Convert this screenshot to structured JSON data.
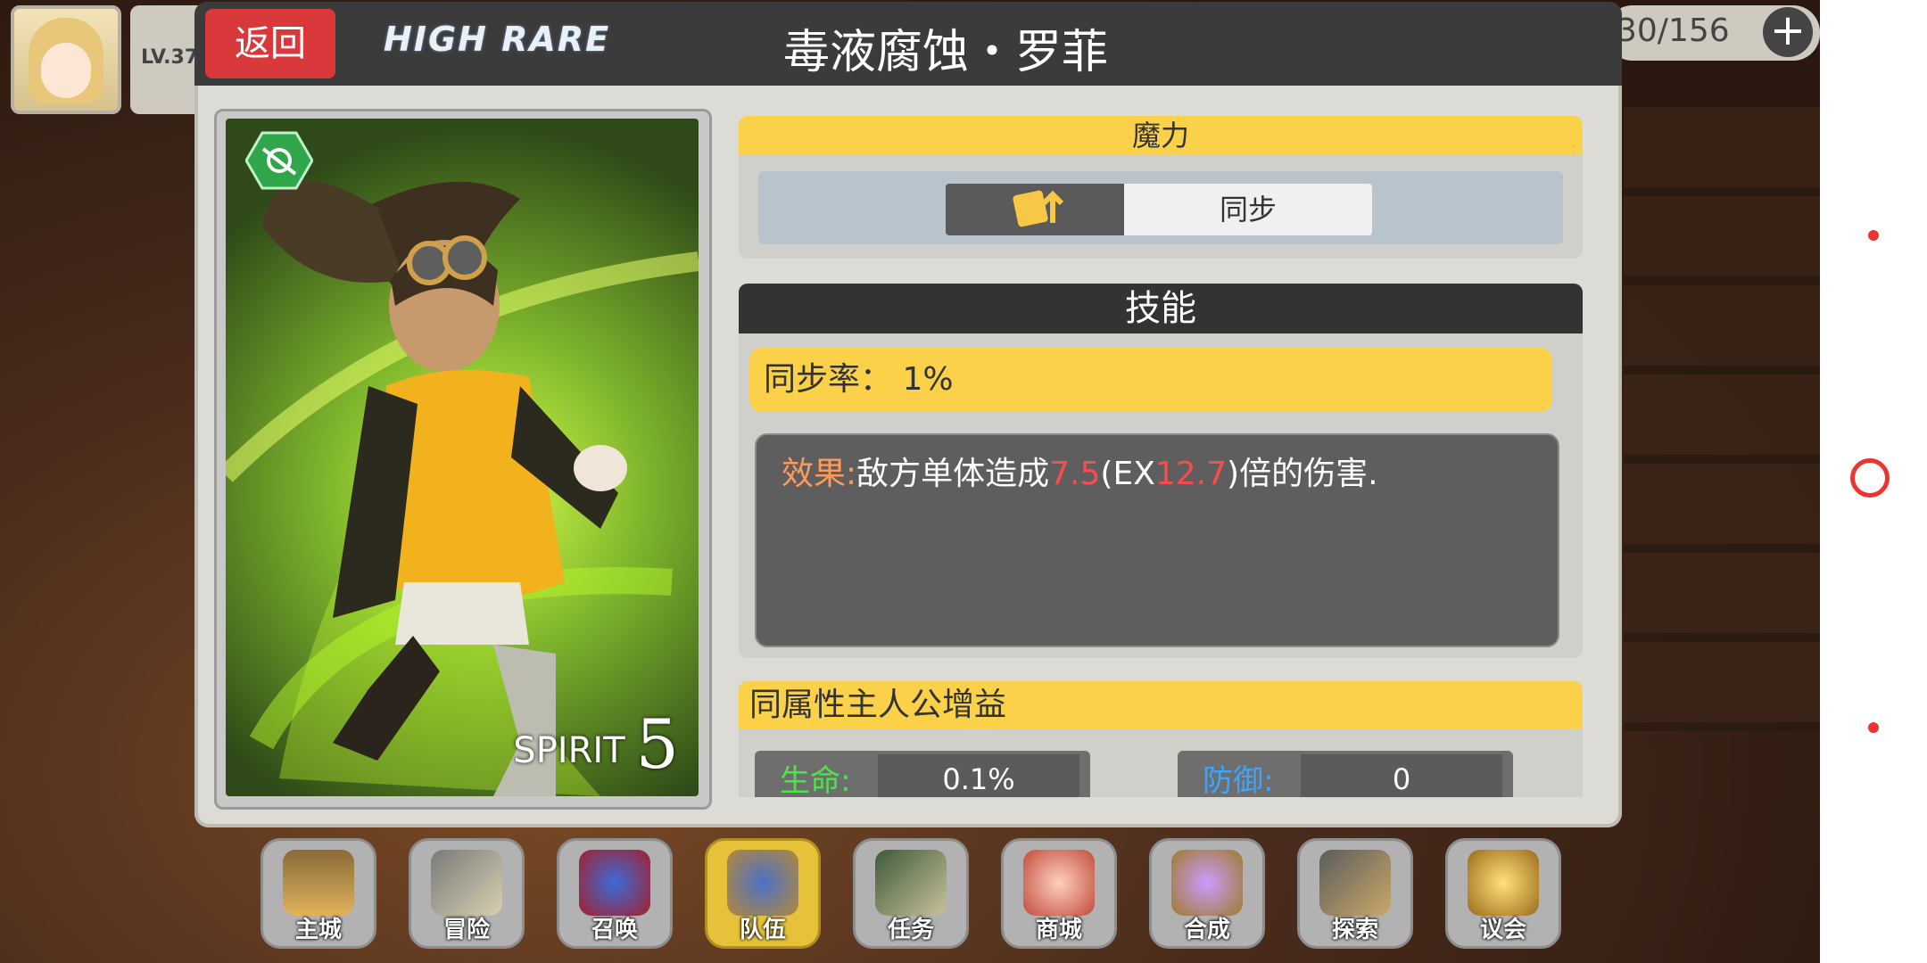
{
  "header": {
    "back_label": "返回",
    "rarity": "HIGH RARE",
    "title": "毒液腐蚀・罗菲"
  },
  "hud": {
    "level": "LV.37",
    "counter": "30/156",
    "plus": "+"
  },
  "card": {
    "spirit_label": "SPIRIT",
    "spirit_value": "5"
  },
  "magic": {
    "header": "魔力",
    "sync_label": "同步"
  },
  "skill": {
    "header": "技能",
    "sync_rate": "同步率： 1%",
    "effect_label": "效果:",
    "effect_text_1": "敌方单体造成",
    "effect_value_1": "7.5",
    "effect_text_2": "(EX",
    "effect_value_2": "12.7",
    "effect_text_3": ")倍的伤害."
  },
  "buff": {
    "header": "同属性主人公增益",
    "hp_label": "生命:",
    "hp_value": "0.1%",
    "def_label": "防御:",
    "def_value": "0"
  },
  "menu": {
    "items": [
      {
        "label": "主城"
      },
      {
        "label": "冒险"
      },
      {
        "label": "召唤"
      },
      {
        "label": "队伍"
      },
      {
        "label": "任务"
      },
      {
        "label": "商城"
      },
      {
        "label": "合成"
      },
      {
        "label": "探索"
      },
      {
        "label": "议会"
      }
    ]
  },
  "colors": {
    "accent_yellow": "#fcd14a",
    "back_red": "#d9393a",
    "header_dark": "#3b3b3b",
    "effect_red": "#ff4a4a",
    "effect_label": "#ff9b5a",
    "hp_green": "#4ee34a",
    "def_blue": "#3aa6ff"
  }
}
